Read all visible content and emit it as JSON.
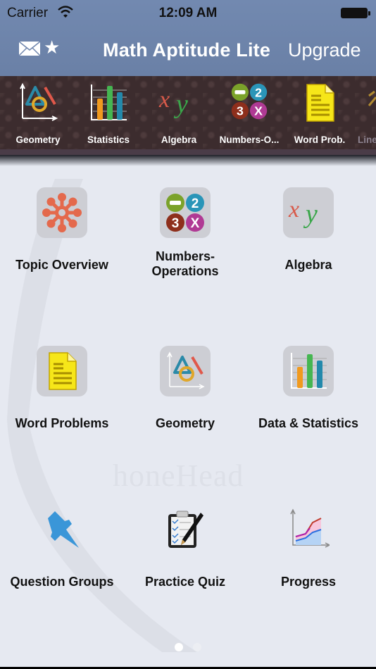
{
  "status_bar": {
    "carrier": "Carrier",
    "time": "12:09 AM"
  },
  "nav_bar": {
    "title": "Math Aptitude Lite",
    "upgrade_label": "Upgrade",
    "icons": [
      "mail-icon",
      "star-icon"
    ]
  },
  "topic_bar": {
    "items": [
      {
        "label": "Geometry",
        "icon": "geometry-icon"
      },
      {
        "label": "Statistics",
        "icon": "bar-chart-icon"
      },
      {
        "label": "Algebra",
        "icon": "xy-algebra-icon"
      },
      {
        "label": "Numbers-O...",
        "icon": "numbers-operations-icon"
      },
      {
        "label": "Word Prob.",
        "icon": "document-icon"
      },
      {
        "label": "Line",
        "icon": "line-icon"
      }
    ]
  },
  "grid": {
    "items": [
      {
        "label": "Topic Overview",
        "icon": "topic-overview-icon"
      },
      {
        "label": "Numbers-\nOperations",
        "line1": "Numbers-",
        "line2": "Operations",
        "icon": "numbers-operations-icon"
      },
      {
        "label": "Algebra",
        "icon": "xy-algebra-icon"
      },
      {
        "label": "Word Problems",
        "icon": "document-icon"
      },
      {
        "label": "Geometry",
        "icon": "geometry-icon"
      },
      {
        "label": "Data & Statistics",
        "icon": "bar-chart-icon"
      },
      {
        "label": "Question Groups",
        "icon": "pushpin-icon"
      },
      {
        "label": "Practice Quiz",
        "icon": "clipboard-pen-icon"
      },
      {
        "label": "Progress",
        "icon": "progress-chart-icon"
      }
    ]
  },
  "watermark": "honeHead",
  "pager": {
    "pages": 2,
    "current": 1
  },
  "colors": {
    "nav": "#6f86ad",
    "topic_bar": "#3c2c2e",
    "background": "#e6e9f1",
    "pin_blue": "#3a96d8"
  }
}
